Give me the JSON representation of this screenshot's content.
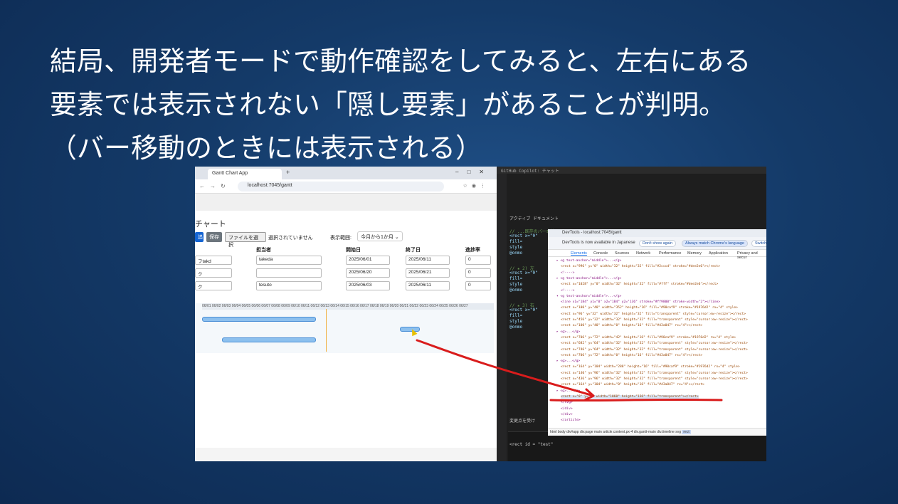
{
  "slide": {
    "title_lines": [
      "結局、開発者モードで動作確認をしてみると、左右にある",
      "要素では表示されない「隠し要素」があることが判明。",
      "（バー移動のときには表示される）"
    ]
  },
  "browser": {
    "tab_title": "Gantt Chart App",
    "url": "localhost:7045/gantt",
    "page_title": "チャート",
    "buttons": {
      "primary": "追",
      "save": "保存",
      "file": "ファイルを選択"
    },
    "file_status": "選択されていません",
    "range_label": "表示範囲:",
    "range_value": "今月から1か月",
    "columns": [
      "担当者",
      "開始日",
      "終了日",
      "進捗率"
    ],
    "rows": [
      {
        "task": "フtakd",
        "assignee": "takeda",
        "start": "2025/06/01",
        "end": "2025/06/11",
        "progress": "0"
      },
      {
        "task": "ク",
        "assignee": "",
        "start": "2025/06/20",
        "end": "2025/06/21",
        "progress": "0"
      },
      {
        "task": "ク",
        "assignee": "tesuto",
        "start": "2025/06/03",
        "end": "2025/06/11",
        "progress": "0"
      }
    ],
    "gantt_dates": "06/01 06/02 06/03 06/04 06/05 06/06 06/07 06/08 06/09 06/10 06/11 06/12 06/13 06/14 06/15 06/16 06/17 06/18 06/19 06/20 06/21 06/22 06/23 06/24 06/25 06/26 06/27"
  },
  "editor": {
    "top_label": "GitHub Copilot: チャット",
    "section": "アクティブ ドキュメント",
    "lines": [
      "// ...既存のバー本体",
      "<rect x=\"0\"",
      "  fill=",
      "  style",
      "  @onmo",
      "// ★ 2) 左",
      "<rect x=\"0\"",
      "  fill=",
      "  style",
      "  @onmo",
      "// ★ 3) 右",
      "<rect x=\"0\"",
      "  fill=",
      "  style",
      "  @onmo"
    ],
    "bottom_text": "<rect id = \"test\"",
    "bottom_label": "変更点を受け"
  },
  "devtools": {
    "title": "DevTools - localhost:7045/gantt",
    "info": "DevTools is now available in Japanese",
    "pill_dont": "Don't show again",
    "pill_match": "Always match Chrome's language",
    "pill_switch": "Switch",
    "tabs": [
      "Elements",
      "Console",
      "Sources",
      "Network",
      "Performance",
      "Memory",
      "Application",
      "Privacy and secur"
    ],
    "code": [
      "▸ <g text-anchor=\"middle\">...</g>",
      "  <rect x=\"996\" y=\"0\" width=\"32\" height=\"32\" fill=\"#2cccd\" stroke=\"#dee2e6\"></rect>",
      "  <!---->",
      "▸ <g text-anchor=\"middle\">...</g>",
      "  <rect x=\"1028\" y=\"0\" width=\"32\" height=\"32\" fill=\"#fff\" stroke=\"#dee2e6\"></rect>",
      "  <!---->",
      "▾ <g text-anchor=\"middle\">...</g>",
      "  <line x1=\"184\" y1=\"0\" x2=\"184\" y2=\"136\" stroke=\"#ff9800\" stroke-width=\"2\"></line>",
      "  <rect x=\"100\" y=\"40\" width=\"352\" height=\"16\" fill=\"#90caf9\" stroke=\"#1976d2\" rx=\"4\" style>",
      "  <rect x=\"96\" y=\"32\" width=\"32\" height=\"32\" fill=\"transparent\" style=\"cursor:ew-resize\"></rect>",
      "  <rect x=\"456\" y=\"32\" width=\"32\" height=\"32\" fill=\"transparent\" style=\"cursor:ew-resize\"></rect>",
      "  <rect x=\"100\" y=\"40\" width=\"0\" height=\"16\" fill=\"#43a047\" rx=\"4\"></rect>",
      "▸ <g>...</g>",
      "  <rect x=\"706\" y=\"72\" width=\"42\" height=\"16\" fill=\"#90caf9\" stroke=\"#1976d2\" rx=\"4\" style>",
      "  <rect x=\"682\" y=\"64\" width=\"32\" height=\"32\" fill=\"transparent\" style=\"cursor:ew-resize\"></rect>",
      "  <rect x=\"746\" y=\"64\" width=\"32\" height=\"32\" fill=\"transparent\" style=\"cursor:ew-resize\"></rect>",
      "  <rect x=\"706\" y=\"72\" width=\"0\" height=\"16\" fill=\"#43a047\" rx=\"4\"></rect>",
      "▸ <g>...</g>",
      "  <rect x=\"164\" y=\"104\" width=\"288\" height=\"16\" fill=\"#90caf9\" stroke=\"#1976d2\" rx=\"4\" style>",
      "  <rect x=\"140\" y=\"96\" width=\"32\" height=\"32\" fill=\"transparent\" style=\"cursor:ew-resize\"></rect>",
      "  <rect x=\"436\" y=\"96\" width=\"32\" height=\"32\" fill=\"transparent\" style=\"cursor:ew-resize\"></rect>",
      "  <rect x=\"164\" y=\"104\" width=\"0\" height=\"16\" fill=\"#43a047\" rx=\"4\"></rect>",
      "▸ <g>...</g>",
      "  <rect x=\"0\" y=\"0\" width=\"1060\" height=\"136\" fill=\"transparent\"></rect>",
      "  </svg>",
      " </div>",
      " </div>",
      "</article>"
    ],
    "crumbs": "html  body  div#app  div.page  main  article.content.px-4  div.gantt-main  div.timeline  svg",
    "crumb_last": "rect"
  }
}
